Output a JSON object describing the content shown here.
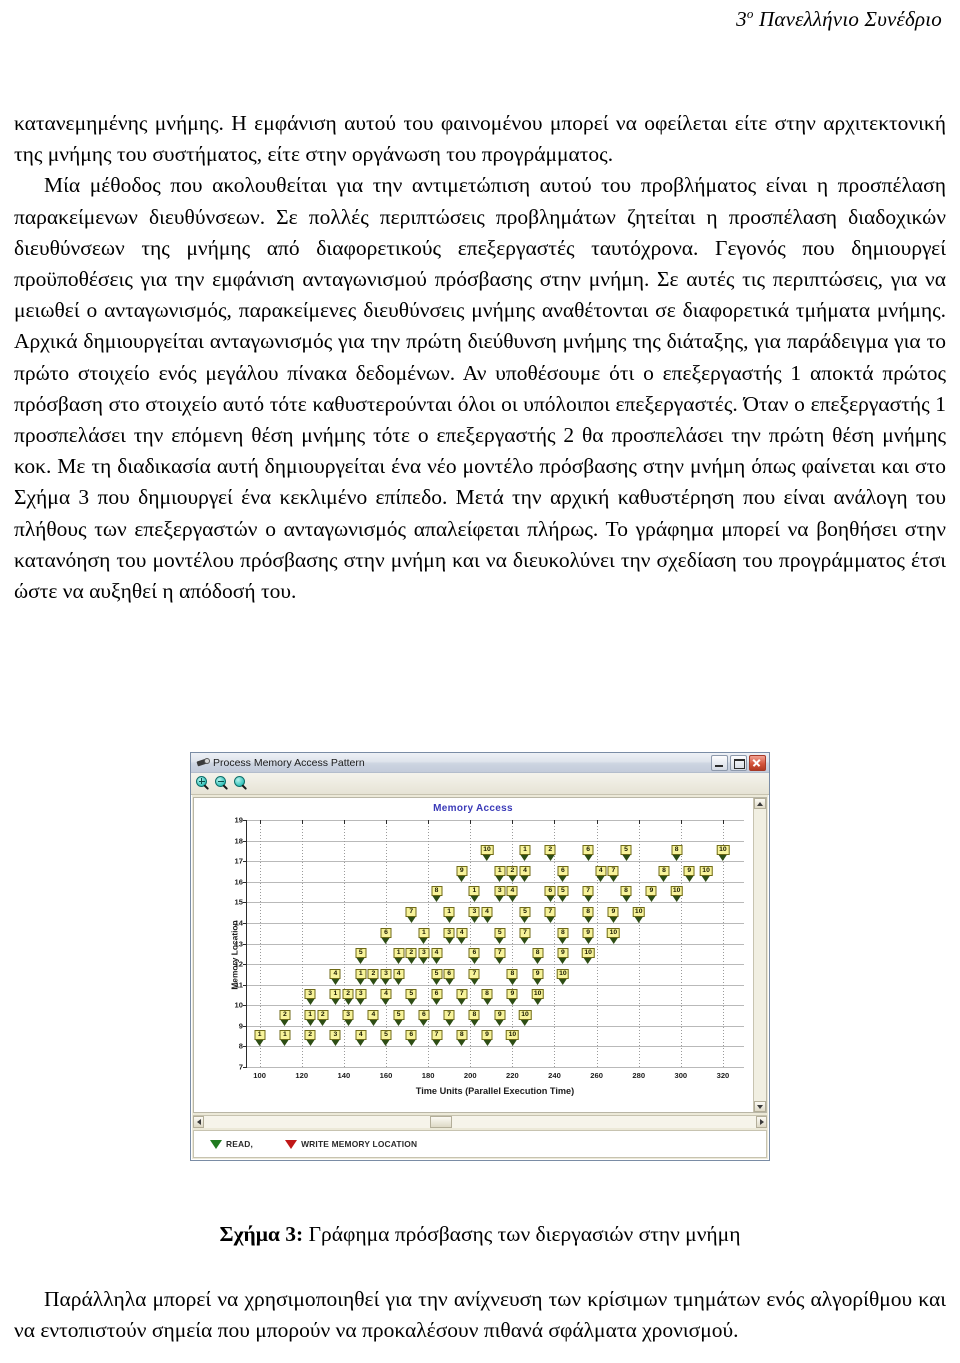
{
  "header": {
    "ordinal": "3",
    "superscript": "ο",
    "text": " Πανελλήνιο Συνέδριο"
  },
  "body": {
    "paragraph_1": "κατανεμημένης μνήμης. Η εμφάνιση αυτού του φαινομένου μπορεί να οφείλεται είτε στην αρχιτεκτονική της μνήμης του συστήματος, είτε στην οργάνωση του προγράμματος.",
    "paragraph_2": "Μία μέθοδος που ακολουθείται για την αντιμετώπιση αυτού του προβλήματος είναι η προσπέλαση παρακείμενων διευθύνσεων. Σε πολλές περιπτώσεις προβλημάτων ζητείται η προσπέλαση διαδοχικών διευθύνσεων της μνήμης από διαφορετικούς επεξεργαστές ταυτόχρονα. Γεγονός που δημιουργεί προϋποθέσεις για την εμφάνιση ανταγωνισμού πρόσβασης στην μνήμη. Σε αυτές τις περιπτώσεις, για να μειωθεί ο ανταγωνισμός, παρακείμενες διευθύνσεις μνήμης αναθέτονται σε διαφορετικά τμήματα μνήμης. Αρχικά δημιουργείται ανταγωνισμός για την πρώτη διεύθυνση μνήμης της διάταξης, για παράδειγμα για το πρώτο στοιχείο ενός μεγάλου πίνακα δεδομένων. Αν υποθέσουμε ότι ο επεξεργαστής 1 αποκτά πρώτος πρόσβαση στο στοιχείο αυτό τότε καθυστερούνται όλοι οι υπόλοιποι επεξεργαστές. Όταν ο επεξεργαστής 1 προσπελάσει την επόμενη θέση μνήμης τότε ο επεξεργαστής 2 θα προσπελάσει την πρώτη θέση μνήμης κοκ. Με τη διαδικασία αυτή δημιουργείται ένα νέο μοντέλο πρόσβασης στην μνήμη όπως φαίνεται και στο Σχήμα 3 που δημιουργεί ένα κεκλιμένο επίπεδο. Μετά την αρχική καθυστέρηση που είναι ανάλογη του πλήθους των επεξεργαστών ο ανταγωνισμός απαλείφεται πλήρως. Το γράφημα μπορεί να βοηθήσει στην κατανόηση του μοντέλου πρόσβασης στην μνήμη και να διευκολύνει την σχεδίαση του προγράμματος έτσι ώστε να αυξηθεί η απόδοσή του."
  },
  "app_window": {
    "title": "Process Memory Access Pattern",
    "titlebar_buttons": {
      "minimize": "minimize-button",
      "maximize": "maximize-button",
      "close": "close-button"
    },
    "toolbar": {
      "zoom_in": "zoom-in-icon",
      "zoom_out": "zoom-out-icon",
      "zoom_reset": "zoom-reset-icon"
    },
    "legend": {
      "read_label": "READ,",
      "write_label": "WRITE MEMORY LOCATION",
      "read_color": "#1f7a1f",
      "write_color": "#c01717"
    }
  },
  "chart_data": {
    "type": "scatter",
    "title": "Memory Access",
    "xlabel": "Time Units (Parallel Execution Time)",
    "ylabel": "Memory Location",
    "xlim": [
      94,
      330
    ],
    "ylim": [
      7,
      19
    ],
    "xticks": [
      100,
      120,
      140,
      160,
      180,
      200,
      220,
      240,
      260,
      280,
      300,
      320
    ],
    "yticks": [
      7,
      8,
      9,
      10,
      11,
      12,
      13,
      14,
      15,
      16,
      17,
      18,
      19
    ],
    "grid": true,
    "title_color": "#3a3ab8",
    "marker_fill": "#f7f39a",
    "marker_border": "#6f6a18",
    "legend_position": "below-plot",
    "series": [
      {
        "name": "READ",
        "color": "#2d4d14",
        "points": [
          {
            "x": 100,
            "y": 8,
            "label": "1"
          },
          {
            "x": 112,
            "y": 8,
            "label": "1"
          },
          {
            "x": 124,
            "y": 8,
            "label": "2"
          },
          {
            "x": 136,
            "y": 8,
            "label": "3"
          },
          {
            "x": 148,
            "y": 8,
            "label": "4"
          },
          {
            "x": 160,
            "y": 8,
            "label": "5"
          },
          {
            "x": 172,
            "y": 8,
            "label": "6"
          },
          {
            "x": 184,
            "y": 8,
            "label": "7"
          },
          {
            "x": 196,
            "y": 8,
            "label": "8"
          },
          {
            "x": 208,
            "y": 8,
            "label": "9"
          },
          {
            "x": 220,
            "y": 8,
            "label": "10"
          },
          {
            "x": 112,
            "y": 9,
            "label": "2"
          },
          {
            "x": 124,
            "y": 9,
            "label": "1"
          },
          {
            "x": 130,
            "y": 9,
            "label": "2"
          },
          {
            "x": 142,
            "y": 9,
            "label": "3"
          },
          {
            "x": 154,
            "y": 9,
            "label": "4"
          },
          {
            "x": 166,
            "y": 9,
            "label": "5"
          },
          {
            "x": 178,
            "y": 9,
            "label": "6"
          },
          {
            "x": 190,
            "y": 9,
            "label": "7"
          },
          {
            "x": 202,
            "y": 9,
            "label": "8"
          },
          {
            "x": 214,
            "y": 9,
            "label": "9"
          },
          {
            "x": 226,
            "y": 9,
            "label": "10"
          },
          {
            "x": 124,
            "y": 10,
            "label": "3"
          },
          {
            "x": 136,
            "y": 10,
            "label": "1"
          },
          {
            "x": 142,
            "y": 10,
            "label": "2"
          },
          {
            "x": 148,
            "y": 10,
            "label": "3"
          },
          {
            "x": 160,
            "y": 10,
            "label": "4"
          },
          {
            "x": 172,
            "y": 10,
            "label": "5"
          },
          {
            "x": 184,
            "y": 10,
            "label": "6"
          },
          {
            "x": 196,
            "y": 10,
            "label": "7"
          },
          {
            "x": 208,
            "y": 10,
            "label": "8"
          },
          {
            "x": 220,
            "y": 10,
            "label": "9"
          },
          {
            "x": 232,
            "y": 10,
            "label": "10"
          },
          {
            "x": 136,
            "y": 11,
            "label": "4"
          },
          {
            "x": 148,
            "y": 11,
            "label": "1"
          },
          {
            "x": 154,
            "y": 11,
            "label": "2"
          },
          {
            "x": 160,
            "y": 11,
            "label": "3"
          },
          {
            "x": 166,
            "y": 11,
            "label": "4"
          },
          {
            "x": 184,
            "y": 11,
            "label": "5"
          },
          {
            "x": 190,
            "y": 11,
            "label": "6"
          },
          {
            "x": 202,
            "y": 11,
            "label": "7"
          },
          {
            "x": 220,
            "y": 11,
            "label": "8"
          },
          {
            "x": 232,
            "y": 11,
            "label": "9"
          },
          {
            "x": 244,
            "y": 11,
            "label": "10"
          },
          {
            "x": 148,
            "y": 12,
            "label": "5"
          },
          {
            "x": 166,
            "y": 12,
            "label": "1"
          },
          {
            "x": 172,
            "y": 12,
            "label": "2"
          },
          {
            "x": 178,
            "y": 12,
            "label": "3"
          },
          {
            "x": 184,
            "y": 12,
            "label": "4"
          },
          {
            "x": 202,
            "y": 12,
            "label": "6"
          },
          {
            "x": 214,
            "y": 12,
            "label": "7"
          },
          {
            "x": 232,
            "y": 12,
            "label": "8"
          },
          {
            "x": 244,
            "y": 12,
            "label": "9"
          },
          {
            "x": 256,
            "y": 12,
            "label": "10"
          },
          {
            "x": 160,
            "y": 13,
            "label": "6"
          },
          {
            "x": 178,
            "y": 13,
            "label": "1"
          },
          {
            "x": 190,
            "y": 13,
            "label": "3"
          },
          {
            "x": 196,
            "y": 13,
            "label": "4"
          },
          {
            "x": 214,
            "y": 13,
            "label": "5"
          },
          {
            "x": 226,
            "y": 13,
            "label": "7"
          },
          {
            "x": 244,
            "y": 13,
            "label": "8"
          },
          {
            "x": 256,
            "y": 13,
            "label": "9"
          },
          {
            "x": 268,
            "y": 13,
            "label": "10"
          },
          {
            "x": 172,
            "y": 14,
            "label": "7"
          },
          {
            "x": 190,
            "y": 14,
            "label": "1"
          },
          {
            "x": 202,
            "y": 14,
            "label": "3"
          },
          {
            "x": 208,
            "y": 14,
            "label": "4"
          },
          {
            "x": 226,
            "y": 14,
            "label": "5"
          },
          {
            "x": 238,
            "y": 14,
            "label": "7"
          },
          {
            "x": 256,
            "y": 14,
            "label": "8"
          },
          {
            "x": 268,
            "y": 14,
            "label": "9"
          },
          {
            "x": 280,
            "y": 14,
            "label": "10"
          },
          {
            "x": 184,
            "y": 15,
            "label": "8"
          },
          {
            "x": 202,
            "y": 15,
            "label": "1"
          },
          {
            "x": 214,
            "y": 15,
            "label": "3"
          },
          {
            "x": 220,
            "y": 15,
            "label": "4"
          },
          {
            "x": 238,
            "y": 15,
            "label": "6"
          },
          {
            "x": 244,
            "y": 15,
            "label": "5"
          },
          {
            "x": 256,
            "y": 15,
            "label": "7"
          },
          {
            "x": 274,
            "y": 15,
            "label": "8"
          },
          {
            "x": 286,
            "y": 15,
            "label": "9"
          },
          {
            "x": 298,
            "y": 15,
            "label": "10"
          },
          {
            "x": 196,
            "y": 16,
            "label": "9"
          },
          {
            "x": 214,
            "y": 16,
            "label": "1"
          },
          {
            "x": 220,
            "y": 16,
            "label": "2"
          },
          {
            "x": 226,
            "y": 16,
            "label": "4"
          },
          {
            "x": 244,
            "y": 16,
            "label": "6"
          },
          {
            "x": 262,
            "y": 16,
            "label": "4"
          },
          {
            "x": 268,
            "y": 16,
            "label": "7"
          },
          {
            "x": 292,
            "y": 16,
            "label": "8"
          },
          {
            "x": 304,
            "y": 16,
            "label": "9"
          },
          {
            "x": 312,
            "y": 16,
            "label": "10"
          },
          {
            "x": 208,
            "y": 17,
            "label": "10"
          },
          {
            "x": 226,
            "y": 17,
            "label": "1"
          },
          {
            "x": 238,
            "y": 17,
            "label": "2"
          },
          {
            "x": 256,
            "y": 17,
            "label": "6"
          },
          {
            "x": 274,
            "y": 17,
            "label": "5"
          },
          {
            "x": 298,
            "y": 17,
            "label": "8"
          },
          {
            "x": 320,
            "y": 17,
            "label": "10"
          }
        ]
      }
    ]
  },
  "caption": {
    "bold": "Σχήμα 3:",
    "text": " Γράφημα πρόσβασης των διεργασιών στην μνήμη"
  },
  "tail_paragraph": "Παράλληλα μπορεί να χρησιμοποιηθεί για την ανίχνευση των κρίσιμων τμημάτων ενός αλγορίθμου και να εντοπιστούν σημεία που μπορούν να προκαλέσουν πιθανά σφάλματα χρονισμού."
}
